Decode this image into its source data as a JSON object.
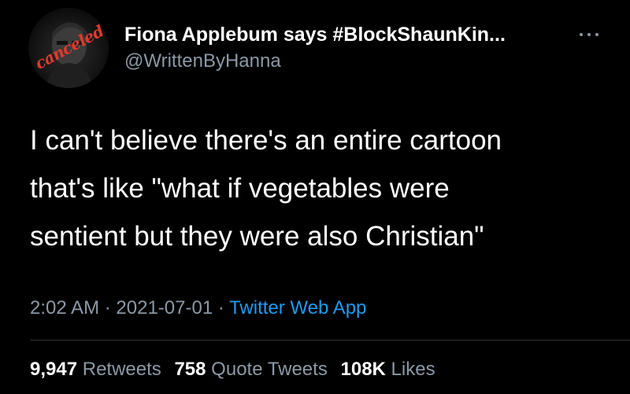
{
  "user": {
    "display_name": "Fiona Applebum says #BlockShaunKin...",
    "handle": "@WrittenByHanna",
    "avatar_stamp": "canceled"
  },
  "tweet": {
    "lines": [
      "I can't believe there's an entire cartoon",
      "that's like \"what if vegetables were",
      "sentient but they were also Christian\""
    ],
    "time": "2:02 AM",
    "date": "2021-07-01",
    "separator": "·",
    "source": "Twitter Web App"
  },
  "stats": {
    "retweets": {
      "count": "9,947",
      "label": "Retweets"
    },
    "quotes": {
      "count": "758",
      "label": "Quote Tweets"
    },
    "likes": {
      "count": "108K",
      "label": "Likes"
    }
  },
  "colors": {
    "background": "#000000",
    "primary_text": "#ffffff",
    "secondary_text": "#8b98a5",
    "link": "#1d9bf0",
    "stamp": "#e23a2b"
  },
  "icons": {
    "more": "more-horizontal-icon"
  }
}
